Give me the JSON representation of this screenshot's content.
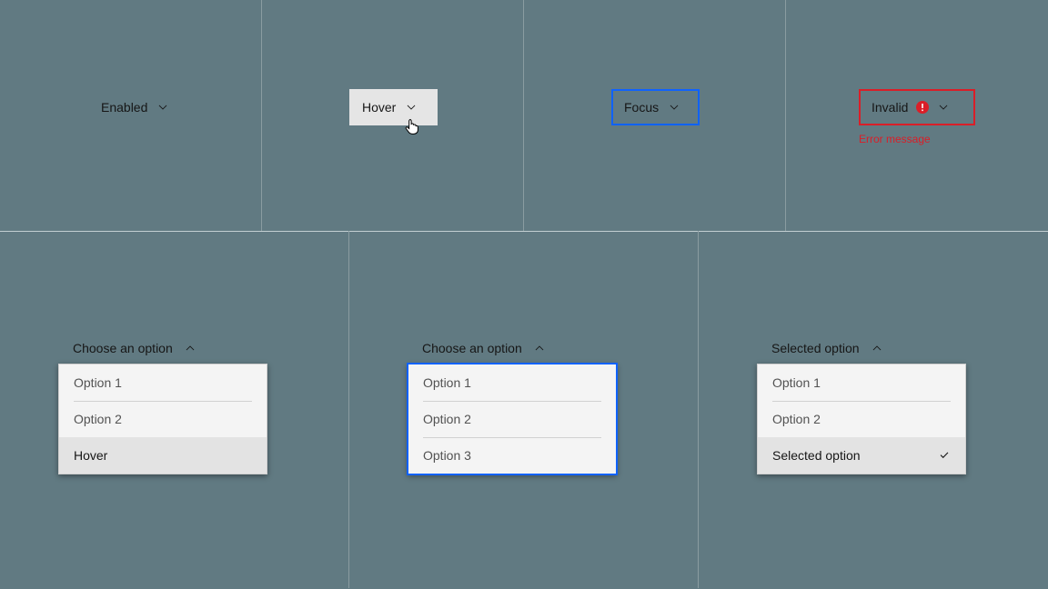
{
  "states": {
    "enabled": {
      "label": "Enabled"
    },
    "hover": {
      "label": "Hover"
    },
    "focus": {
      "label": "Focus"
    },
    "invalid": {
      "label": "Invalid",
      "error": "Error message"
    }
  },
  "menus": {
    "hover": {
      "label": "Choose an option",
      "items": [
        "Option 1",
        "Option 2",
        "Hover"
      ]
    },
    "focus": {
      "label": "Choose an option",
      "items": [
        "Option 1",
        "Option 2",
        "Option 3"
      ]
    },
    "selected": {
      "label": "Selected option",
      "items": [
        "Option 1",
        "Option 2",
        "Selected option"
      ]
    }
  },
  "colors": {
    "focus": "#0f62fe",
    "error": "#da1e28",
    "bg": "#617a82"
  }
}
